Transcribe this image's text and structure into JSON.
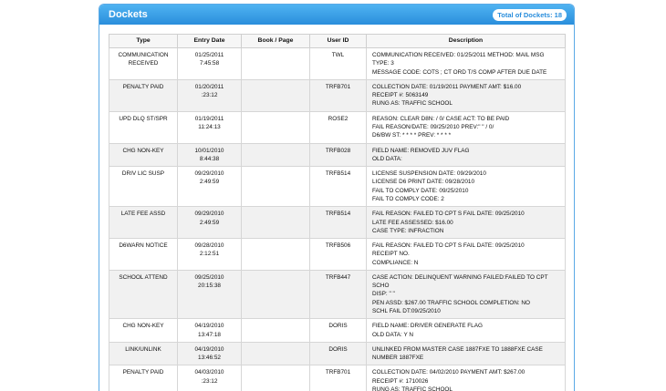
{
  "panel": {
    "title": "Dockets",
    "total": "Total of Dockets: 18"
  },
  "columns": [
    "Type",
    "Entry Date",
    "Book / Page",
    "User ID",
    "Description"
  ],
  "rows": [
    {
      "type": [
        "COMMUNICATION",
        "RECEIVED"
      ],
      "date": [
        "01/25/2011",
        "7:45:58"
      ],
      "book": "",
      "user": "TWL",
      "desc": [
        "COMMUNICATION RECEIVED: 01/25/2011 METHOD: MAIL MSG",
        "TYPE: 3",
        "MESSAGE CODE: COTS ; CT ORD T/S COMP AFTER DUE DATE"
      ]
    },
    {
      "type": [
        "PENALTY PAID"
      ],
      "date": [
        "01/20/2011",
        ":23:12"
      ],
      "book": "",
      "user": "TRFB701",
      "desc": [
        "COLLECTION DATE: 01/19/2011 PAYMENT AMT: $16.00",
        "RECEIPT #: 5063149",
        "RUNG AS: TRAFFIC SCHOOL"
      ]
    },
    {
      "type": [
        "UPD DLQ ST/SPR"
      ],
      "date": [
        "01/19/2011",
        "11:24:13"
      ],
      "book": "",
      "user": "ROSE2",
      "desc": [
        "REASON: CLEAR D8N: / 0/ CASE ACT: TO BE PAID",
        "FAIL REASON/DATE: 09/25/2010 PREV:\" \" / 0/",
        "D6/BW ST: * * * * PREV: * * * *"
      ]
    },
    {
      "type": [
        "CHG NON-KEY"
      ],
      "date": [
        "10/01/2010",
        "8:44:38"
      ],
      "book": "",
      "user": "TRFB028",
      "desc": [
        "FIELD NAME: REMOVED JUV FLAG",
        "OLD DATA:"
      ]
    },
    {
      "type": [
        "DRIV LIC SUSP"
      ],
      "date": [
        "09/29/2010",
        "2:49:59"
      ],
      "book": "",
      "user": "TRFB514",
      "desc": [
        "LICENSE SUSPENSION DATE: 09/29/2010",
        "LICENSE D6 PRINT DATE: 09/28/2010",
        "FAIL TO COMPLY DATE: 09/25/2010",
        "FAIL TO COMPLY CODE: 2"
      ]
    },
    {
      "type": [
        "LATE FEE ASSD"
      ],
      "date": [
        "09/29/2010",
        "2:49:59"
      ],
      "book": "",
      "user": "TRFB514",
      "desc": [
        "FAIL REASON: FAILED TO CPT S FAIL DATE: 09/25/2010",
        "LATE FEE ASSESSED: $16.00",
        "CASE TYPE: INFRACTION"
      ]
    },
    {
      "type": [
        "D6WARN NOTICE"
      ],
      "date": [
        "09/28/2010",
        "2:12:51"
      ],
      "book": "",
      "user": "TRFB506",
      "desc": [
        "FAIL REASON: FAILED TO CPT S FAIL DATE: 09/25/2010",
        "RECEIPT NO.",
        "COMPLIANCE: N"
      ]
    },
    {
      "type": [
        "SCHOOL ATTEND"
      ],
      "date": [
        "09/25/2010",
        "20:15:38"
      ],
      "book": "",
      "user": "TRFB447",
      "desc": [
        "CASE ACTION: DELINQUENT WARNING FAILED:FAILED TO CPT",
        "SCHO",
        "DISP: \" \"",
        "PEN ASSD: $267.00 TRAFFIC SCHOOL COMPLETION: NO",
        "SCHL FAIL DT:09/25/2010"
      ]
    },
    {
      "type": [
        "CHG NON-KEY"
      ],
      "date": [
        "04/19/2010",
        "13:47:18"
      ],
      "book": "",
      "user": "DORIS",
      "desc": [
        "FIELD NAME: DRIVER GENERATE FLAG",
        "OLD DATA: Y N"
      ]
    },
    {
      "type": [
        "LINK/UNLINK"
      ],
      "date": [
        "04/19/2010",
        "13:46:52"
      ],
      "book": "",
      "user": "DORIS",
      "desc": [
        "UNLINKED FROM MASTER CASE 1887FXE TO 1888FXE CASE",
        "NUMBER 1887FXE"
      ]
    },
    {
      "type": [
        "PENALTY PAID"
      ],
      "date": [
        "04/03/2010",
        ":23:12"
      ],
      "book": "",
      "user": "TRFB701",
      "desc": [
        "COLLECTION DATE: 04/02/2010 PAYMENT AMT: $267.00",
        "RECEIPT #: 1710026",
        "RUNG AS: TRAFFIC SCHOOL"
      ]
    }
  ]
}
